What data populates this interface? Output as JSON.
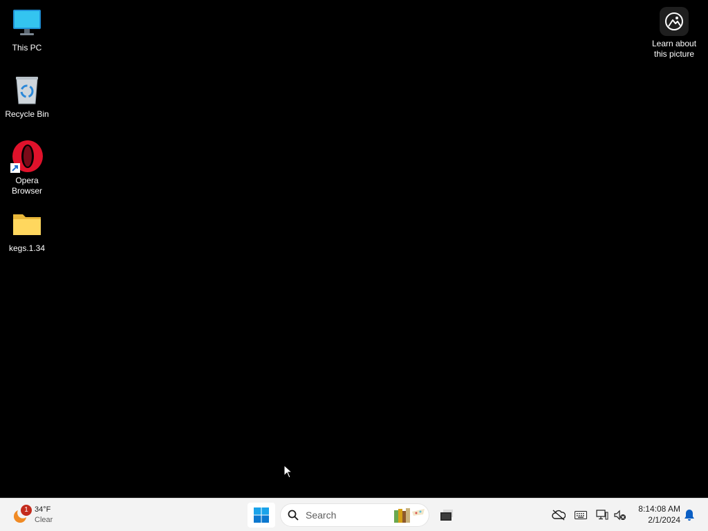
{
  "desktop": {
    "icons": [
      {
        "label": "This PC",
        "icon": "this-pc-icon"
      },
      {
        "label": "Recycle Bin",
        "icon": "recycle-bin-icon"
      },
      {
        "label_line1": "Opera",
        "label_line2": "Browser",
        "icon": "opera-browser-icon"
      },
      {
        "label": "kegs.1.34",
        "icon": "folder-icon"
      }
    ],
    "spotlight": {
      "line1": "Learn about",
      "line2": "this picture",
      "icon": "spotlight-icon"
    }
  },
  "taskbar": {
    "weather": {
      "temp": "34°F",
      "condition": "Clear",
      "badge": "1",
      "icon": "weather-icon"
    },
    "start_icon": "windows-start-icon",
    "search": {
      "placeholder": "Search",
      "icon": "search-icon"
    },
    "pinned_app_icon": "window-app-icon",
    "tray_icons": [
      "onedrive-offline-icon",
      "keyboard-icon",
      "network-icon",
      "volume-muted-icon"
    ],
    "clock": {
      "time": "8:14:08 AM",
      "date": "2/1/2024"
    },
    "notification_icon": "bell-icon"
  },
  "colors": {
    "desktop_bg": "#000000",
    "taskbar_bg": "#f3f3f3",
    "start_blue": "#0078d4",
    "badge_red": "#c42b1c"
  }
}
